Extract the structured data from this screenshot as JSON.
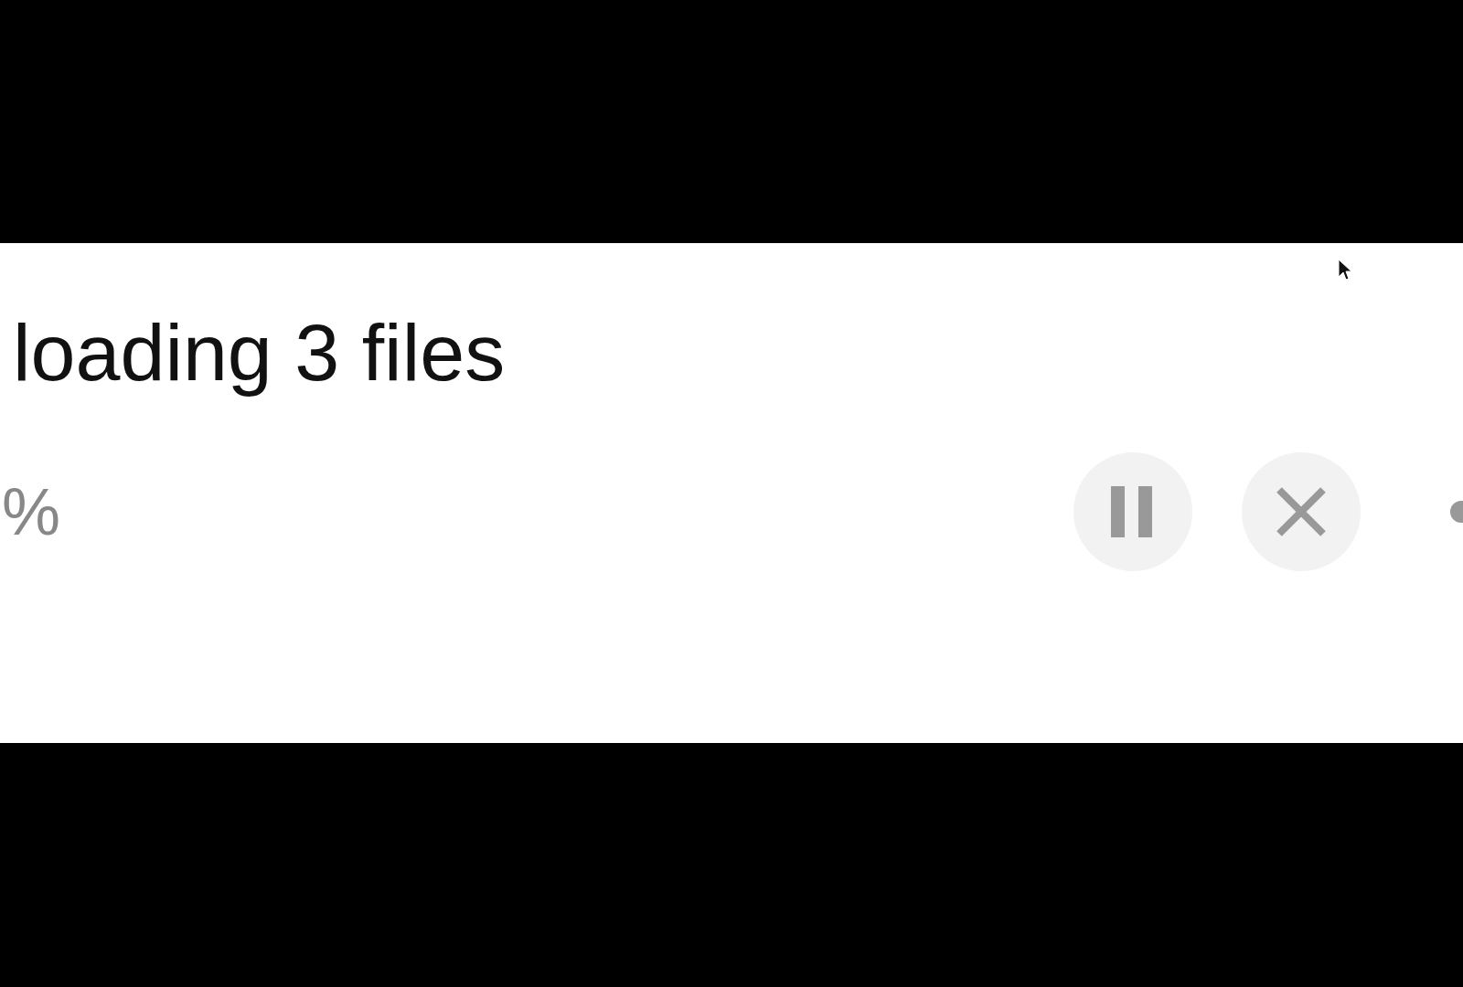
{
  "title": "loading 3 files",
  "progress_text": "%",
  "buttons": [
    {
      "kind": "pause"
    },
    {
      "kind": "cancel"
    }
  ]
}
